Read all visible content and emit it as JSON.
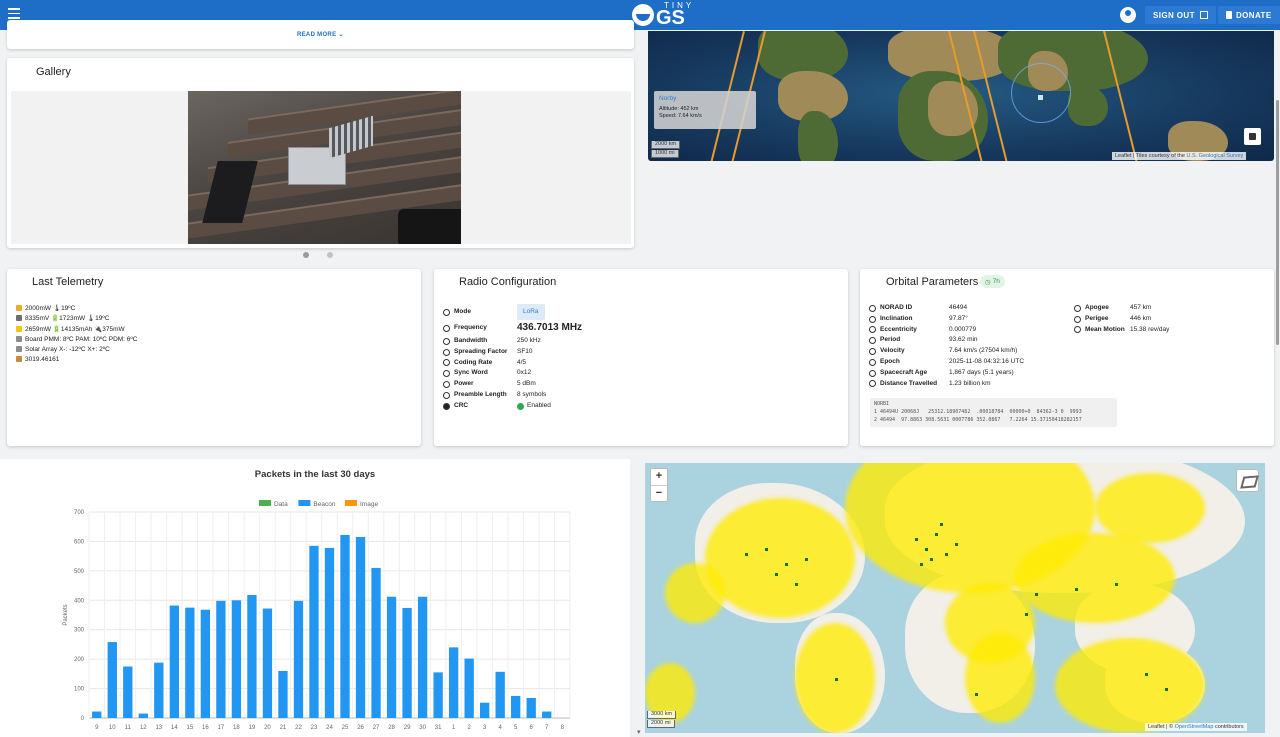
{
  "header": {
    "logo_small": "TINY",
    "logo_big": "GS",
    "sign_out": "SIGN OUT",
    "donate": "DONATE"
  },
  "read_more": "READ MORE ⌄",
  "gallery": {
    "title": "Gallery"
  },
  "sat_map": {
    "popup_name": "Norby",
    "popup_altitude": "Altitude: 452 km",
    "popup_speed": "Speed: 7.64 km/s",
    "scale_km": "2000 km",
    "scale_mi": "1000 mi",
    "attribution_prefix": "Leaflet | Tiles courtesy of the ",
    "attribution_link": "U.S. Geological Survey"
  },
  "telemetry": {
    "title": "Last Telemetry",
    "lines": [
      "2000mW 🌡19ºC",
      "8335mV 🔋1723mW 🌡19ºC",
      "2659mW 🔋14135mAh 🔌375mW",
      "Board PMM: 8ºC PAM: 10ºC PDM: 6ºC",
      "Solar Array X-: -12ºC X+: 2ºC",
      "3019.46161"
    ]
  },
  "radio": {
    "title": "Radio Configuration",
    "rows": [
      {
        "key": "Mode",
        "value": "LoRa"
      },
      {
        "key": "Frequency",
        "value": "436.7013 MHz"
      },
      {
        "key": "Bandwidth",
        "value": "250 kHz"
      },
      {
        "key": "Spreading Factor",
        "value": "SF10"
      },
      {
        "key": "Coding Rate",
        "value": "4/5"
      },
      {
        "key": "Sync Word",
        "value": "0x12"
      },
      {
        "key": "Power",
        "value": "5 dBm"
      },
      {
        "key": "Preamble Length",
        "value": "8 symbols"
      },
      {
        "key": "CRC",
        "value": "Enabled"
      }
    ]
  },
  "orbital": {
    "title": "Orbital Parameters",
    "badge": "7h",
    "left_rows": [
      {
        "key": "NORAD ID",
        "value": "46494"
      },
      {
        "key": "Inclination",
        "value": "97.87°"
      },
      {
        "key": "Eccentricity",
        "value": "0.000779"
      },
      {
        "key": "Period",
        "value": "93.62 min"
      },
      {
        "key": "Velocity",
        "value": "7.64 km/s (27504 km/h)"
      },
      {
        "key": "Epoch",
        "value": "2025-11-08 04:32:16 UTC"
      },
      {
        "key": "Spacecraft Age",
        "value": "1,867 days (5.1 years)"
      },
      {
        "key": "Distance Travelled",
        "value": "1.23 billion km"
      }
    ],
    "right_rows": [
      {
        "key": "Apogee",
        "value": "457 km"
      },
      {
        "key": "Perigee",
        "value": "446 km"
      },
      {
        "key": "Mean Motion",
        "value": "15.38 rev/day"
      }
    ],
    "tle": "NORBI\n1 46494U 20068J   25312.18907482  .00018784  00000+0  84362-3 0  9993\n2 46494  97.8863 308.5631 0007786 352.0867   7.2264 15.37150418282157"
  },
  "packets_chart": {
    "title": "Packets in the last 30 days",
    "legend": [
      {
        "label": "Data",
        "color": "#4caf50"
      },
      {
        "label": "Beacon",
        "color": "#2196f3"
      },
      {
        "label": "Image",
        "color": "#ff9800"
      }
    ]
  },
  "chart_data": {
    "type": "bar",
    "title": "Packets in the last 30 days",
    "xlabel": "",
    "ylabel": "Packets",
    "ylim": [
      0,
      700
    ],
    "yticks": [
      0,
      100,
      200,
      300,
      400,
      500,
      600,
      700
    ],
    "categories": [
      "9",
      "10",
      "11",
      "12",
      "13",
      "14",
      "15",
      "16",
      "17",
      "18",
      "19",
      "20",
      "21",
      "22",
      "23",
      "24",
      "25",
      "26",
      "27",
      "28",
      "29",
      "30",
      "31",
      "1",
      "2",
      "3",
      "4",
      "5",
      "6",
      "7",
      "8"
    ],
    "series": [
      {
        "name": "Data",
        "color": "#4caf50",
        "values": [
          0,
          0,
          0,
          0,
          0,
          0,
          0,
          0,
          0,
          0,
          0,
          0,
          0,
          0,
          0,
          0,
          0,
          0,
          0,
          0,
          0,
          0,
          0,
          0,
          0,
          0,
          0,
          0,
          0,
          0,
          0
        ]
      },
      {
        "name": "Beacon",
        "color": "#2196f3",
        "values": [
          22,
          258,
          175,
          15,
          188,
          382,
          375,
          368,
          398,
          400,
          418,
          372,
          160,
          398,
          585,
          578,
          622,
          615,
          510,
          412,
          374,
          412,
          155,
          240,
          202,
          52,
          157,
          75,
          68,
          22,
          0
        ]
      },
      {
        "name": "Image",
        "color": "#ff9800",
        "values": [
          0,
          0,
          0,
          0,
          0,
          0,
          0,
          0,
          0,
          0,
          0,
          0,
          0,
          0,
          0,
          0,
          0,
          0,
          0,
          0,
          0,
          0,
          0,
          0,
          0,
          0,
          0,
          0,
          0,
          0,
          0
        ]
      }
    ],
    "grid": true,
    "legend_position": "top"
  },
  "world_map": {
    "zoom_in": "+",
    "zoom_out": "−",
    "scale_km": "3000 km",
    "scale_mi": "2000 mi",
    "attribution_prefix": "Leaflet | © ",
    "attribution_link": "OpenStreetMap",
    "attribution_suffix": " contributors"
  },
  "colors": {
    "primary": "#1e6ec8",
    "beacon": "#2196f3",
    "ok": "#2eaa52"
  }
}
